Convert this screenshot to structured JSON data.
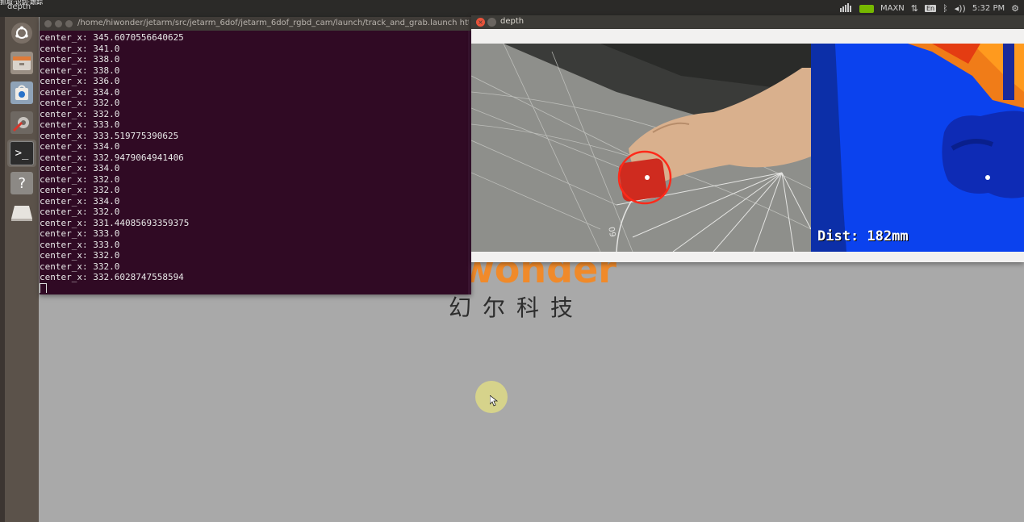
{
  "topbar": {
    "corner_text": "抓取·识别·跟踪",
    "active_window": "depth",
    "tray": {
      "power_mode": "MAXN",
      "keyboard_layout": "En",
      "clock": "5:32 PM",
      "icons": [
        "performance-icon",
        "nvidia-icon",
        "network-icon",
        "keyboard-icon",
        "bluetooth-icon",
        "volume-icon",
        "settings-gear-icon"
      ]
    }
  },
  "launcher": {
    "items": [
      {
        "name": "dash-home-icon"
      },
      {
        "name": "files-icon"
      },
      {
        "name": "software-center-icon"
      },
      {
        "name": "system-settings-icon"
      },
      {
        "name": "terminal-icon"
      },
      {
        "name": "help-icon"
      },
      {
        "name": "drive-icon"
      }
    ]
  },
  "wallpaper": {
    "brand": "Hiwonder",
    "chinese": "幻尔科技"
  },
  "terminal": {
    "title": "/home/hiwonder/jetarm/src/jetarm_6dof/jetarm_6dof_rgbd_cam/launch/track_and_grab.launch http:",
    "lines": [
      "center_x: 345.6070556640625",
      "center_x: 341.0",
      "center_x: 338.0",
      "center_x: 338.0",
      "center_x: 336.0",
      "center_x: 334.0",
      "center_x: 332.0",
      "center_x: 332.0",
      "center_x: 333.0",
      "center_x: 333.519775390625",
      "center_x: 334.0",
      "center_x: 332.9479064941406",
      "center_x: 334.0",
      "center_x: 332.0",
      "center_x: 332.0",
      "center_x: 334.0",
      "center_x: 332.0",
      "center_x: 331.44085693359375",
      "center_x: 333.0",
      "center_x: 333.0",
      "center_x: 332.0",
      "center_x: 332.0",
      "center_x: 332.6028747558594"
    ]
  },
  "depth_window": {
    "title": "depth",
    "distance_label": "Dist: 182mm"
  },
  "colors": {
    "terminal_bg": "#300a24",
    "desktop_bg": "#a9a9a9",
    "launcher_bg": "#5b524a",
    "depth_blue": "#0a3ae0",
    "brand_orange": "#f08a2a",
    "target_red": "#e5261c"
  }
}
